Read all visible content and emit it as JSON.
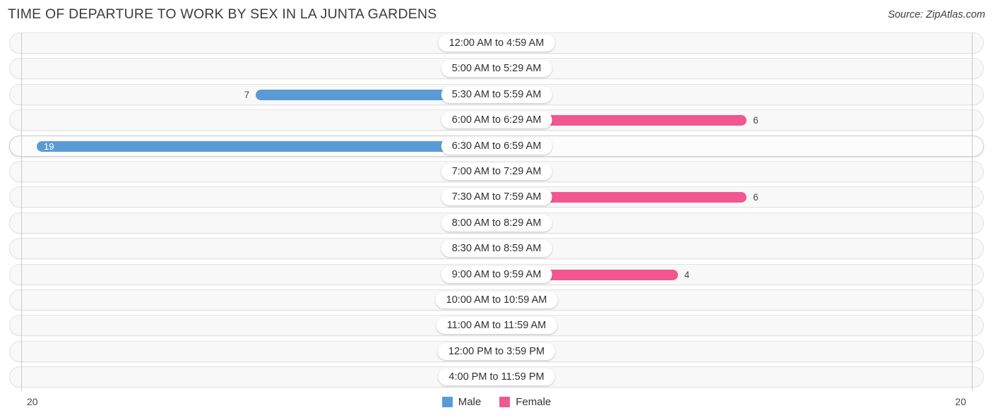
{
  "header": {
    "title": "TIME OF DEPARTURE TO WORK BY SEX IN LA JUNTA GARDENS",
    "source": "Source: ZipAtlas.com"
  },
  "axis": {
    "left_tick": "20",
    "right_tick": "20"
  },
  "legend": {
    "items": [
      {
        "label": "Male",
        "color": "#5b9bd5"
      },
      {
        "label": "Female",
        "color": "#ee5a8e"
      }
    ]
  },
  "colors": {
    "male_light": "#a8c8ec",
    "male_strong": "#5b9bd5",
    "female_light": "#f7a8c7",
    "female_strong": "#f2578f",
    "row_background": "#f8f8f8",
    "row_border": "#e3e3e3",
    "axis_line": "#c9c9c9"
  },
  "chart_data": {
    "type": "bar",
    "title": "TIME OF DEPARTURE TO WORK BY SEX IN LA JUNTA GARDENS",
    "orientation": "horizontal-diverging",
    "xlabel": "",
    "ylabel": "",
    "xlim": [
      20,
      20
    ],
    "grid": false,
    "legend_position": "bottom-center",
    "categories": [
      "12:00 AM to 4:59 AM",
      "5:00 AM to 5:29 AM",
      "5:30 AM to 5:59 AM",
      "6:00 AM to 6:29 AM",
      "6:30 AM to 6:59 AM",
      "7:00 AM to 7:29 AM",
      "7:30 AM to 7:59 AM",
      "8:00 AM to 8:29 AM",
      "8:30 AM to 8:59 AM",
      "9:00 AM to 9:59 AM",
      "10:00 AM to 10:59 AM",
      "11:00 AM to 11:59 AM",
      "12:00 PM to 3:59 PM",
      "4:00 PM to 11:59 PM"
    ],
    "series": [
      {
        "name": "Male",
        "values": [
          0,
          0,
          7,
          0,
          19,
          0,
          0,
          0,
          0,
          0,
          0,
          0,
          0,
          0
        ]
      },
      {
        "name": "Female",
        "values": [
          0,
          0,
          0,
          6,
          0,
          0,
          6,
          0,
          0,
          4,
          0,
          0,
          0,
          0
        ]
      }
    ]
  },
  "rows": [
    {
      "category": "12:00 AM to 4:59 AM",
      "male": "0",
      "female": "0"
    },
    {
      "category": "5:00 AM to 5:29 AM",
      "male": "0",
      "female": "0"
    },
    {
      "category": "5:30 AM to 5:59 AM",
      "male": "7",
      "female": "0"
    },
    {
      "category": "6:00 AM to 6:29 AM",
      "male": "0",
      "female": "6"
    },
    {
      "category": "6:30 AM to 6:59 AM",
      "male": "19",
      "female": "0"
    },
    {
      "category": "7:00 AM to 7:29 AM",
      "male": "0",
      "female": "0"
    },
    {
      "category": "7:30 AM to 7:59 AM",
      "male": "0",
      "female": "6"
    },
    {
      "category": "8:00 AM to 8:29 AM",
      "male": "0",
      "female": "0"
    },
    {
      "category": "8:30 AM to 8:59 AM",
      "male": "0",
      "female": "0"
    },
    {
      "category": "9:00 AM to 9:59 AM",
      "male": "0",
      "female": "4"
    },
    {
      "category": "10:00 AM to 10:59 AM",
      "male": "0",
      "female": "0"
    },
    {
      "category": "11:00 AM to 11:59 AM",
      "male": "0",
      "female": "0"
    },
    {
      "category": "12:00 PM to 3:59 PM",
      "male": "0",
      "female": "0"
    },
    {
      "category": "4:00 PM to 11:59 PM",
      "male": "0",
      "female": "0"
    }
  ]
}
